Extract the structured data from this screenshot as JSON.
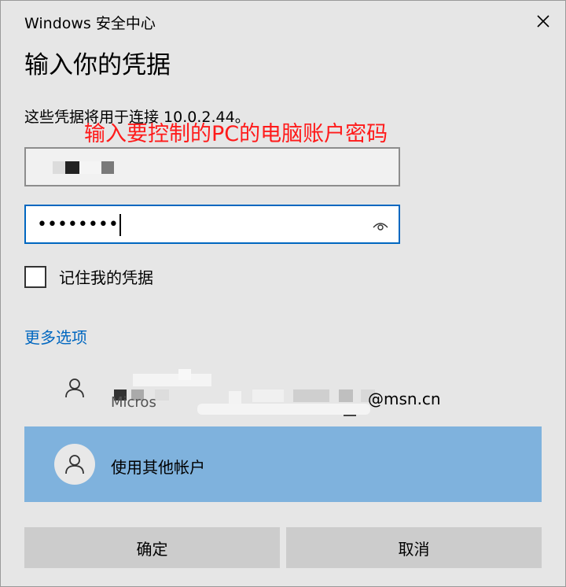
{
  "window": {
    "app_title": "Windows 安全中心"
  },
  "dialog": {
    "heading": "输入你的凭据",
    "description": "这些凭据将用于连接 10.0.2.44。",
    "annotation": "输入要控制的PC的电脑账户密码",
    "username": {
      "value_obscured": true
    },
    "password": {
      "value": "••••••••"
    },
    "remember": {
      "label": "记住我的凭据",
      "checked": false
    },
    "more_options": "更多选项",
    "accounts": [
      {
        "obscured_label": "Micros",
        "email_suffix": "@msn.cn"
      },
      {
        "label": "使用其他帐户",
        "selected": true
      }
    ],
    "buttons": {
      "ok": "确定",
      "cancel": "取消"
    }
  },
  "colors": {
    "background": "#e6e6e6",
    "accent": "#0067c0",
    "selected_row": "#7fb2dd",
    "annotation": "#ff1a1a",
    "button": "#cccccc"
  },
  "icons": {
    "close": "close-icon",
    "reveal": "eye-icon",
    "avatar": "person-icon"
  }
}
